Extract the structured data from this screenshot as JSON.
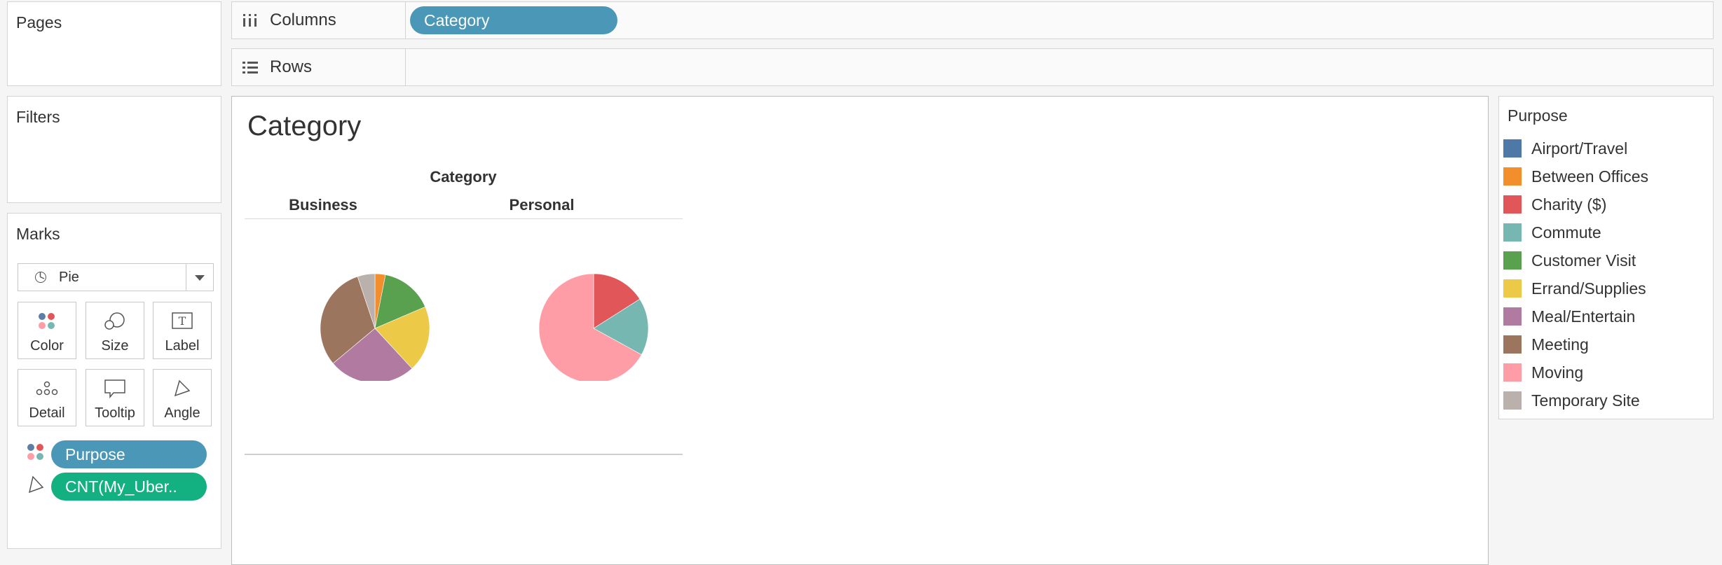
{
  "pages": {
    "title": "Pages"
  },
  "filters": {
    "title": "Filters"
  },
  "shelves": {
    "columns": {
      "label": "Columns",
      "pill": "Category"
    },
    "rows": {
      "label": "Rows"
    }
  },
  "marks": {
    "title": "Marks",
    "mark_type": "Pie",
    "buttons": {
      "color": "Color",
      "size": "Size",
      "label": "Label",
      "detail": "Detail",
      "tooltip": "Tooltip",
      "angle": "Angle"
    },
    "pills": {
      "color": "Purpose",
      "angle": "CNT(My_Uber.."
    },
    "pill_colors": {
      "dimension": "#4a97b7",
      "measure": "#13b081"
    }
  },
  "viz": {
    "title": "Category",
    "header_group": "Category",
    "headers": [
      "Business",
      "Personal"
    ]
  },
  "legend": {
    "title": "Purpose",
    "items": [
      {
        "label": "Airport/Travel",
        "color": "#4e79a7"
      },
      {
        "label": "Between Offices",
        "color": "#f28e2b"
      },
      {
        "label": "Charity ($)",
        "color": "#e15759"
      },
      {
        "label": "Commute",
        "color": "#76b7b2"
      },
      {
        "label": "Customer Visit",
        "color": "#59a14f"
      },
      {
        "label": "Errand/Supplies",
        "color": "#edc948"
      },
      {
        "label": "Meal/Entertain",
        "color": "#b07aa1"
      },
      {
        "label": "Meeting",
        "color": "#9c755f"
      },
      {
        "label": "Moving",
        "color": "#ff9da7"
      },
      {
        "label": "Temporary Site",
        "color": "#bab0ac"
      }
    ]
  },
  "chart_data": {
    "type": "pie",
    "title": "Category",
    "facet": "Category",
    "series": [
      {
        "name": "Business",
        "slices": [
          {
            "label": "Between Offices",
            "value": 3
          },
          {
            "label": "Customer Visit",
            "value": 15
          },
          {
            "label": "Errand/Supplies",
            "value": 19
          },
          {
            "label": "Meal/Entertain",
            "value": 25
          },
          {
            "label": "Meeting",
            "value": 30
          },
          {
            "label": "Temporary Site",
            "value": 5
          }
        ]
      },
      {
        "name": "Personal",
        "slices": [
          {
            "label": "Charity ($)",
            "value": 16
          },
          {
            "label": "Commute",
            "value": 17
          },
          {
            "label": "Moving",
            "value": 67
          }
        ]
      }
    ]
  }
}
